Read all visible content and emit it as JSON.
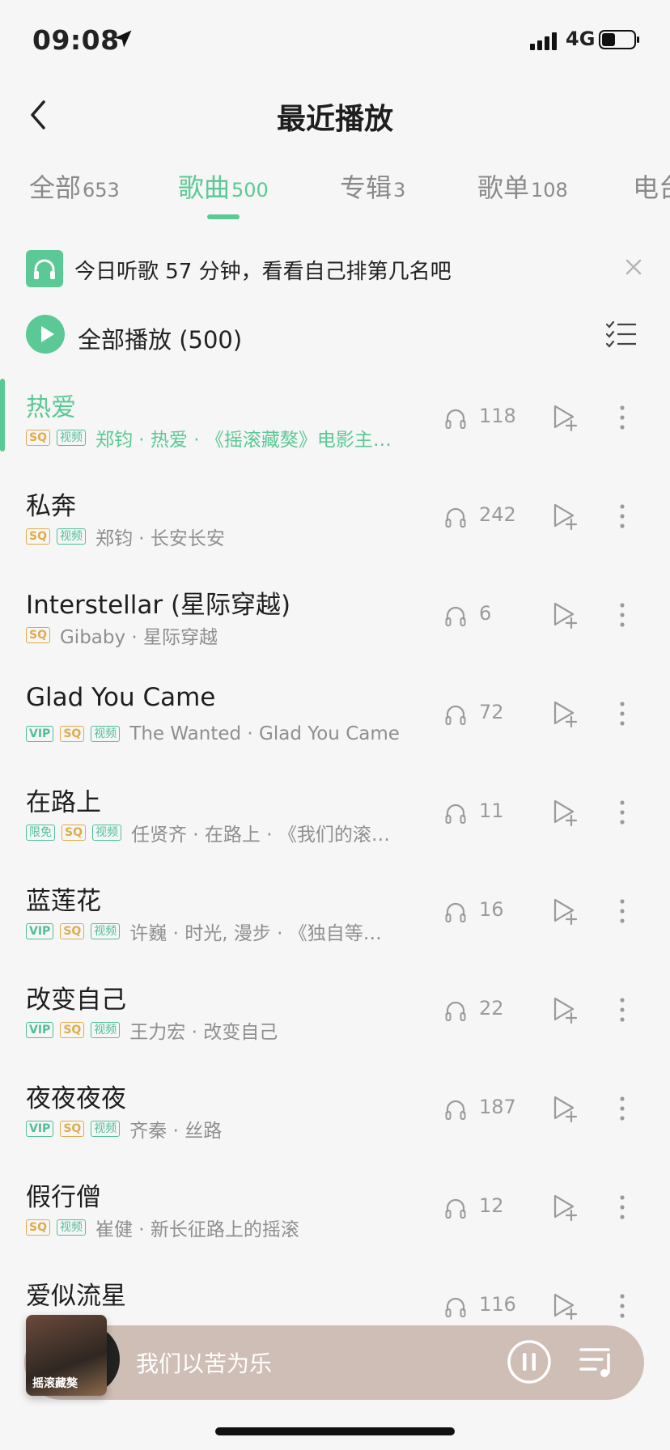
{
  "status_bar": {
    "time": "09:08",
    "network": "4G"
  },
  "header": {
    "title": "最近播放"
  },
  "tabs": [
    {
      "label": "全部",
      "count": "653"
    },
    {
      "label": "歌曲",
      "count": "500",
      "active": true
    },
    {
      "label": "专辑",
      "count": "3"
    },
    {
      "label": "歌单",
      "count": "108"
    },
    {
      "label": "电台",
      "count": ""
    }
  ],
  "banner": {
    "text": "今日听歌 57 分钟，看看自己排第几名吧"
  },
  "play_all": {
    "label": "全部播放 (500)"
  },
  "songs": [
    {
      "title": "热爱",
      "badges": [
        "SQ",
        "视频"
      ],
      "meta": "郑钧 · 热爱 · 《摇滚藏獒》电影主…",
      "plays": "118",
      "playing": true
    },
    {
      "title": "私奔",
      "badges": [
        "SQ",
        "视频"
      ],
      "meta": "郑钧 · 长安长安",
      "plays": "242"
    },
    {
      "title": "Interstellar (星际穿越)",
      "badges": [
        "SQ"
      ],
      "meta": "Gibaby · 星际穿越",
      "plays": "6"
    },
    {
      "title": "Glad You Came",
      "badges": [
        "VIP",
        "SQ",
        "视频"
      ],
      "meta": "The Wanted · Glad You Came",
      "plays": "72"
    },
    {
      "title": "在路上",
      "badges": [
        "限免",
        "SQ",
        "视频"
      ],
      "meta": "任贤齐 · 在路上 · 《我们的滚…",
      "plays": "11"
    },
    {
      "title": "蓝莲花",
      "badges": [
        "VIP",
        "SQ",
        "视频"
      ],
      "meta": "许巍 · 时光, 漫步 · 《独自等…",
      "plays": "16"
    },
    {
      "title": "改变自己",
      "badges": [
        "VIP",
        "SQ",
        "视频"
      ],
      "meta": "王力宏 · 改变自己",
      "plays": "22"
    },
    {
      "title": "夜夜夜夜",
      "badges": [
        "VIP",
        "SQ",
        "视频"
      ],
      "meta": "齐秦 · 丝路",
      "plays": "187"
    },
    {
      "title": "假行僧",
      "badges": [
        "SQ",
        "视频"
      ],
      "meta": "崔健 · 新长征路上的摇滚",
      "plays": "12"
    },
    {
      "title": "爱似流星",
      "badges": [],
      "meta": "",
      "plays": "116"
    }
  ],
  "player": {
    "title": "我们以苦为乐",
    "cover_text": "摇滚藏獒"
  },
  "colors": {
    "accent": "#5bc995",
    "sq": "#e0ac4a",
    "player_bg": "#cfbeb6"
  }
}
